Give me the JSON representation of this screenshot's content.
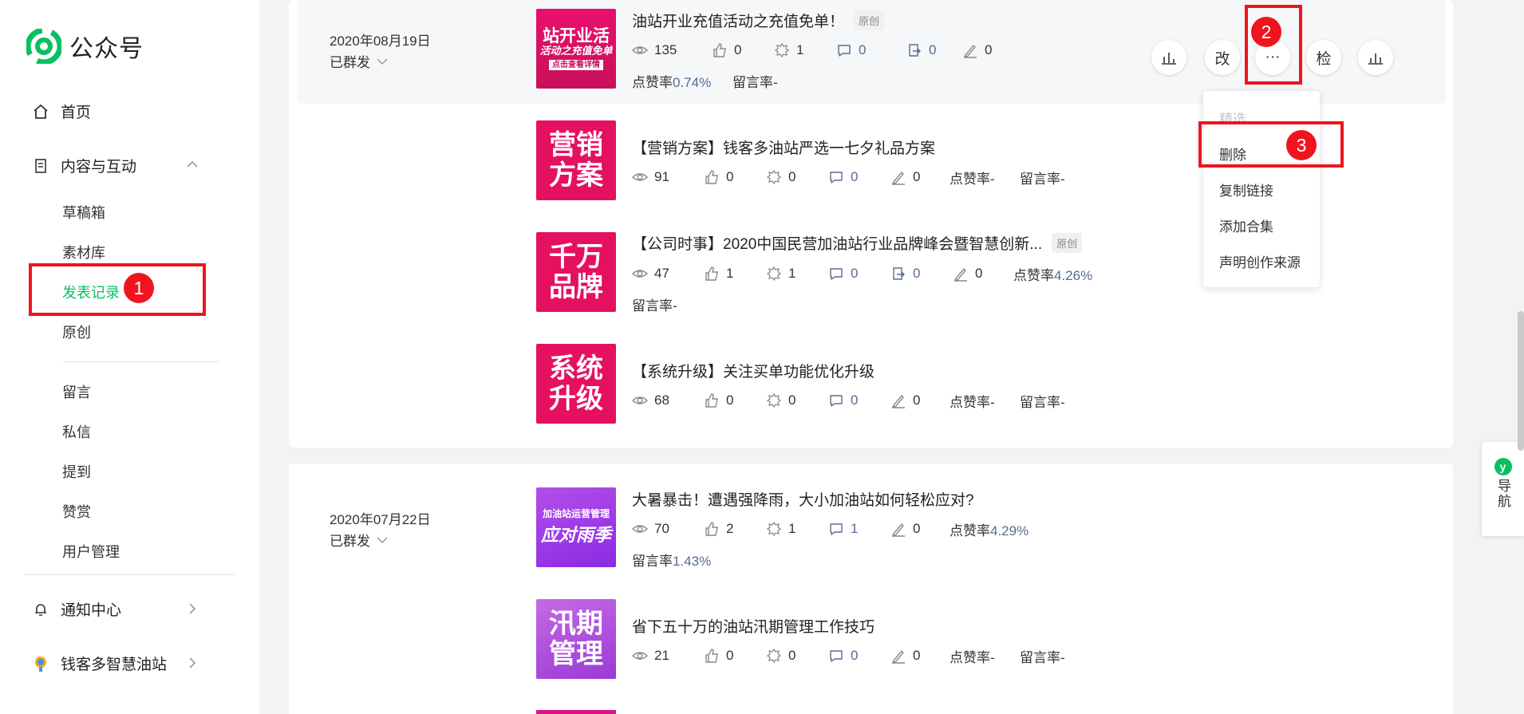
{
  "sidebar": {
    "logo_text": "公众号",
    "home": "首页",
    "content_group": "内容与互动",
    "sub_items": [
      "草稿箱",
      "素材库",
      "发表记录",
      "原创"
    ],
    "sub_items2": [
      "留言",
      "私信",
      "提到",
      "赞赏",
      "用户管理"
    ],
    "notify": "通知中心",
    "account": "钱客多智慧油站"
  },
  "groups": [
    {
      "date": "2020年08月19日",
      "status": "已群发",
      "articles": [
        {
          "thumb_lines": [
            "站开业活",
            "活动之充值免单",
            "点击查看详情"
          ],
          "title": "油站开业充值活动之充值免单！",
          "tag": "原创",
          "views": "135",
          "likes": "0",
          "wows": "1",
          "comments": "0",
          "shares": "0",
          "edits": "0",
          "like_rate_label": "点赞率",
          "like_rate": "0.74%",
          "comment_rate_label": "留言率",
          "comment_rate": "-"
        },
        {
          "thumb_lines": [
            "营销",
            "方案"
          ],
          "title": "【营销方案】钱客多油站严选一七夕礼品方案",
          "views": "91",
          "likes": "0",
          "wows": "0",
          "comments": "0",
          "edits": "0",
          "like_rate_label": "点赞率",
          "like_rate": "-",
          "comment_rate_label": "留言率",
          "comment_rate": "-"
        },
        {
          "thumb_lines": [
            "千万",
            "品牌"
          ],
          "title": "【公司时事】2020中国民营加油站行业品牌峰会暨智慧创新...",
          "tag": "原创",
          "views": "47",
          "likes": "1",
          "wows": "1",
          "comments": "0",
          "shares": "0",
          "edits": "0",
          "like_rate_label": "点赞率",
          "like_rate": "4.26%",
          "comment_rate_label": "留言率",
          "comment_rate": "-"
        },
        {
          "thumb_lines": [
            "系统",
            "升级"
          ],
          "title": "【系统升级】关注买单功能优化升级",
          "views": "68",
          "likes": "0",
          "wows": "0",
          "comments": "0",
          "edits": "0",
          "like_rate_label": "点赞率",
          "like_rate": "-",
          "comment_rate_label": "留言率",
          "comment_rate": "-"
        }
      ]
    },
    {
      "date": "2020年07月22日",
      "status": "已群发",
      "articles": [
        {
          "thumb_lines": [
            "加油站运营管理",
            "应对雨季"
          ],
          "title": "大暑暴击！遭遇强降雨，大小加油站如何轻松应对?",
          "views": "70",
          "likes": "2",
          "wows": "1",
          "comments": "1",
          "edits": "0",
          "like_rate_label": "点赞率",
          "like_rate": "4.29%",
          "comment_rate_label": "留言率",
          "comment_rate": "1.43%"
        },
        {
          "thumb_lines": [
            "汛期",
            "管理"
          ],
          "title": "省下五十万的油站汛期管理工作技巧",
          "views": "21",
          "likes": "0",
          "wows": "0",
          "comments": "0",
          "edits": "0",
          "like_rate_label": "点赞率",
          "like_rate": "-",
          "comment_rate_label": "留言率",
          "comment_rate": "-"
        }
      ]
    }
  ],
  "actions": {
    "edit": "改",
    "more": "···",
    "check": "检"
  },
  "menu": [
    "精选",
    "删除",
    "复制链接",
    "添加合集",
    "声明创作来源"
  ],
  "annotations": [
    "1",
    "2",
    "3"
  ],
  "guide": {
    "icon": "y",
    "label": "导航"
  },
  "colors": {
    "accent": "#07c160",
    "link": "#576b95",
    "annotation": "#f0141e"
  }
}
